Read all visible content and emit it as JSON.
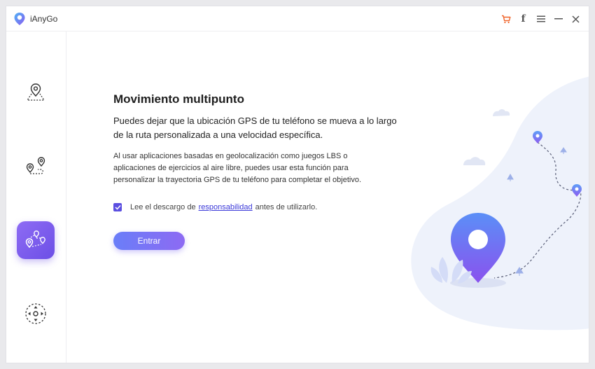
{
  "app": {
    "title": "iAnyGo"
  },
  "titlebar": {
    "icons": [
      "cart-icon",
      "facebook-icon",
      "menu-icon",
      "minimize-icon",
      "close-icon"
    ],
    "facebook_glyph": "f"
  },
  "sidebar": {
    "items": [
      {
        "name": "sidebar-item-change-location",
        "icon": "map-pin-icon",
        "active": false
      },
      {
        "name": "sidebar-item-two-spot",
        "icon": "two-pin-route-icon",
        "active": false
      },
      {
        "name": "sidebar-item-multi-spot",
        "icon": "multi-pin-route-icon",
        "active": true
      },
      {
        "name": "sidebar-item-joystick",
        "icon": "joystick-icon",
        "active": false
      }
    ]
  },
  "main": {
    "heading": "Movimiento multipunto",
    "lead": "Puedes dejar que la ubicación GPS de tu teléfono se mueva a lo largo de la ruta personalizada a una velocidad específica.",
    "detail": "Al usar aplicaciones basadas en geolocalización como juegos LBS o aplicaciones de ejercicios al aire libre, puedes usar esta función para personalizar la trayectoria GPS de tu teléfono para completar el objetivo.",
    "agree": {
      "checked": true,
      "prefix": "Lee el descargo de",
      "link": "responsabilidad",
      "suffix": "antes de utilizarlo."
    },
    "enter_label": "Entrar"
  },
  "colors": {
    "accent": "#6c4fe6",
    "button_start": "#6a7ef8",
    "button_end": "#8d6af3",
    "link": "#3a38d8",
    "cart": "#f0642a"
  }
}
